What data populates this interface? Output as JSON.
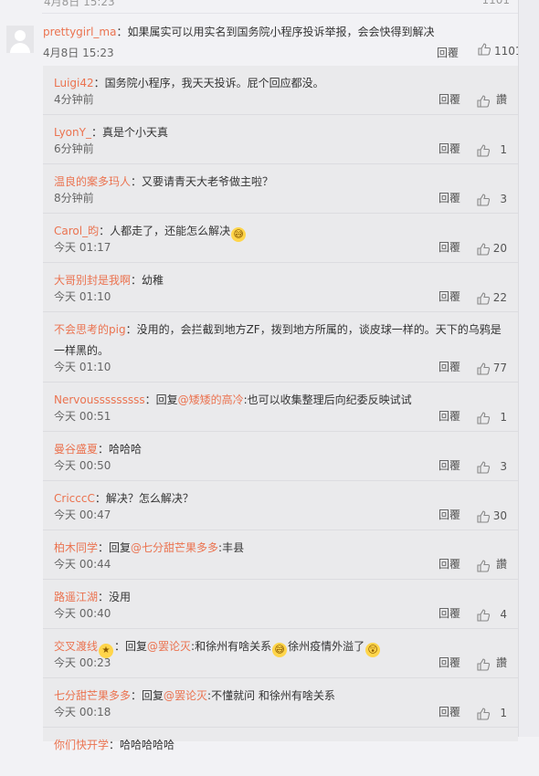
{
  "top_partial": {
    "time": "4月8日 15:23",
    "likes": "1101"
  },
  "main_comment": {
    "user": "prettygirl_ma",
    "text": "：如果属实可以用实名到国务院小程序投诉举报，会会快得到解决",
    "time": "4月8日 15:23",
    "reply_label": "回覆",
    "likes": "1101"
  },
  "replies": [
    {
      "user": "Luigi42",
      "text": "：国务院小程序，我天天投诉。屁个回应都没。",
      "time": "4分钟前",
      "reply_label": "回覆",
      "likes": "讚"
    },
    {
      "user": "LyonY_",
      "text": "：真是个小天真",
      "time": "6分钟前",
      "reply_label": "回覆",
      "likes": "1"
    },
    {
      "user": "温良的案多玛人",
      "text": "：又要请青天大老爷做主啦？",
      "time": "8分钟前",
      "reply_label": "回覆",
      "likes": "3"
    },
    {
      "user": "Carol_昀",
      "text": "：人都走了，还能怎么解决",
      "emoji": "sweat-smile-emoji",
      "time": "今天 01:17",
      "reply_label": "回覆",
      "likes": "20"
    },
    {
      "user": "大哥别封是我啊",
      "text": "：幼稚",
      "time": "今天 01:10",
      "reply_label": "回覆",
      "likes": "22"
    },
    {
      "user": "不会思考的pig",
      "text": "：没用的，会拦截到地方ZF，拨到地方所属的，谈皮球一样的。天下的乌鸦是一样黑的。",
      "time": "今天 01:10",
      "reply_label": "回覆",
      "likes": "77"
    },
    {
      "user": "Nervousssssssss",
      "text": "：回复",
      "mention": "@矮矮的高冷",
      "text2": ":也可以收集整理后向纪委反映试试",
      "time": "今天 00:51",
      "reply_label": "回覆",
      "likes": "1"
    },
    {
      "user": "曼谷盛夏",
      "text": "：哈哈哈",
      "time": "今天 00:50",
      "reply_label": "回覆",
      "likes": "3"
    },
    {
      "user": "CricccC",
      "text": "：解决？怎么解决？",
      "time": "今天 00:47",
      "reply_label": "回覆",
      "likes": "30"
    },
    {
      "user": "柏木同学",
      "text": "：回复",
      "mention": "@七分甜芒果多多",
      "text2": ":丰县",
      "time": "今天 00:44",
      "reply_label": "回覆",
      "likes": "讚"
    },
    {
      "user": "路遥江湖",
      "text": "：没用",
      "time": "今天 00:40",
      "reply_label": "回覆",
      "likes": "4"
    },
    {
      "user": "交叉渡线",
      "text": "：回复",
      "mention": "@罢论灭",
      "text2": ":和徐州有啥关系",
      "text3": "徐州疫情外溢了",
      "time": "今天 00:23",
      "reply_label": "回覆",
      "likes": "讚"
    },
    {
      "user": "七分甜芒果多多",
      "text": "：回复",
      "mention": "@罢论灭",
      "text2": ":不懂就问 和徐州有啥关系",
      "time": "今天 00:18",
      "reply_label": "回覆",
      "likes": "1"
    },
    {
      "user": "你们快开学",
      "text": "：哈哈哈哈哈"
    }
  ]
}
